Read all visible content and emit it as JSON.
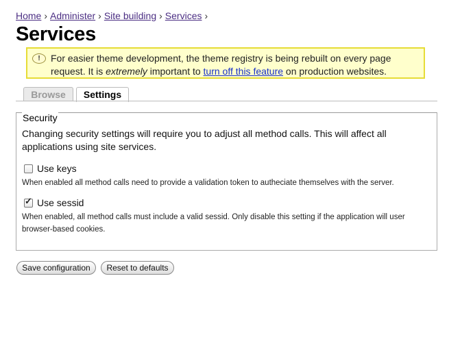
{
  "breadcrumb": {
    "items": [
      "Home",
      "Administer",
      "Site building",
      "Services"
    ],
    "separator": "›"
  },
  "page": {
    "title": "Services"
  },
  "warning": {
    "icon": "exclamation-icon",
    "text_before": "For easier theme development, the theme registry is being rebuilt on every page request. It is ",
    "emphasis": "extremely",
    "text_middle": " important to ",
    "link": "turn off this feature",
    "text_after": " on production websites."
  },
  "tabs": [
    {
      "label": "Browse",
      "active": false
    },
    {
      "label": "Settings",
      "active": true
    }
  ],
  "security": {
    "legend": "Security",
    "description": "Changing security settings will require you to adjust all method calls. This will affect all applications using site services.",
    "use_keys": {
      "label": "Use keys",
      "checked": false,
      "help": "When enabled all method calls need to provide a validation token to autheciate themselves with the server."
    },
    "use_sessid": {
      "label": "Use sessid",
      "checked": true,
      "help": "When enabled, all method calls must include a valid sessid. Only disable this setting if the application will user browser-based cookies."
    }
  },
  "buttons": {
    "save": "Save configuration",
    "reset": "Reset to defaults"
  },
  "colors": {
    "link": "#4b2e83",
    "warning_bg": "#ffffcc",
    "warning_border": "#e6dc35"
  }
}
